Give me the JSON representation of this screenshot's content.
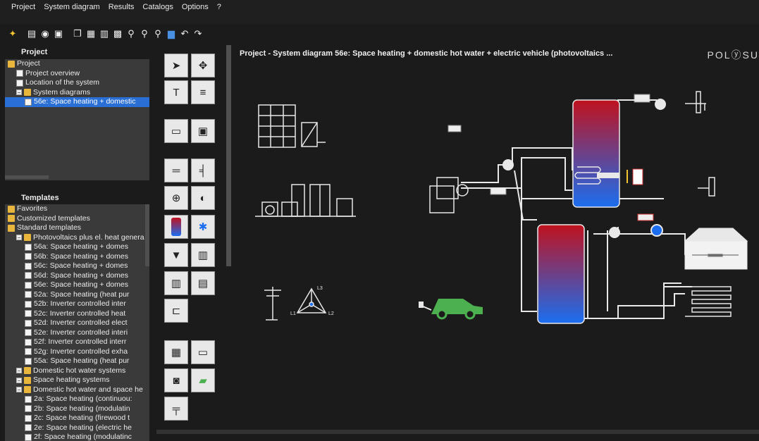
{
  "menu": [
    "Project",
    "System diagram",
    "Results",
    "Catalogs",
    "Options",
    "?"
  ],
  "toolbar_icons": [
    "wizard-icon",
    "new-icon",
    "open-icon",
    "save-icon",
    "copy-icon",
    "paste-icon",
    "delete-icon",
    "save-as-icon",
    "zoom-icon",
    "zoom-in-icon",
    "zoom-out-icon",
    "chart-icon",
    "undo-icon",
    "redo-icon"
  ],
  "project_panel": {
    "title": "Project",
    "items": [
      {
        "label": "Project",
        "level": 0,
        "icon": "folder"
      },
      {
        "label": "Project overview",
        "level": 1,
        "icon": "doc"
      },
      {
        "label": "Location of the system",
        "level": 1,
        "icon": "doc"
      },
      {
        "label": "System diagrams",
        "level": 1,
        "icon": "folder"
      },
      {
        "label": "56e: Space heating + domestic",
        "level": 2,
        "icon": "doc",
        "selected": true
      }
    ]
  },
  "templates_panel": {
    "title": "Templates",
    "items": [
      {
        "label": "Favorites",
        "level": 0,
        "icon": "folder"
      },
      {
        "label": "Customized templates",
        "level": 0,
        "icon": "folder"
      },
      {
        "label": "Standard templates",
        "level": 0,
        "icon": "folder"
      },
      {
        "label": "Photovoltaics plus el. heat genera",
        "level": 1,
        "icon": "folder"
      },
      {
        "label": "56a: Space heating + domes",
        "level": 2,
        "icon": "doc"
      },
      {
        "label": "56b: Space heating + domes",
        "level": 2,
        "icon": "doc"
      },
      {
        "label": "56c: Space heating + domes",
        "level": 2,
        "icon": "doc"
      },
      {
        "label": "56d: Space heating + domes",
        "level": 2,
        "icon": "doc"
      },
      {
        "label": "56e: Space heating + domes",
        "level": 2,
        "icon": "doc"
      },
      {
        "label": "52a: Space heating (heat pur",
        "level": 2,
        "icon": "doc"
      },
      {
        "label": "52b: Inverter controlled inter",
        "level": 2,
        "icon": "doc"
      },
      {
        "label": "52c: Inverter controlled heat",
        "level": 2,
        "icon": "doc"
      },
      {
        "label": "52d: Inverter controlled elect",
        "level": 2,
        "icon": "doc"
      },
      {
        "label": "52e: Inverter controlled interi",
        "level": 2,
        "icon": "doc"
      },
      {
        "label": "52f: Inverter controlled interr",
        "level": 2,
        "icon": "doc"
      },
      {
        "label": "52g: Inverter controlled exha",
        "level": 2,
        "icon": "doc"
      },
      {
        "label": "55a: Space heating (heat pur",
        "level": 2,
        "icon": "doc"
      },
      {
        "label": "Domestic hot water systems",
        "level": 1,
        "icon": "folder"
      },
      {
        "label": "Space heating systems",
        "level": 1,
        "icon": "folder"
      },
      {
        "label": "Domestic hot water and space he",
        "level": 1,
        "icon": "folder"
      },
      {
        "label": "2a: Space heating (continuou:",
        "level": 2,
        "icon": "doc"
      },
      {
        "label": "2b: Space heating (modulatin",
        "level": 2,
        "icon": "doc"
      },
      {
        "label": "2c: Space heating (firewood t",
        "level": 2,
        "icon": "doc"
      },
      {
        "label": "2e: Space heating (electric he",
        "level": 2,
        "icon": "doc"
      },
      {
        "label": "2f: Space heating (modulatinc",
        "level": 2,
        "icon": "doc"
      }
    ]
  },
  "canvas": {
    "title": "Project - System diagram 56e: Space heating + domestic hot water + electric vehicle (photovoltaics ...",
    "logo": "POLⓨSU",
    "grid_labels": {
      "l1": "L1",
      "l2": "L2",
      "l3": "L3"
    }
  },
  "colors": {
    "background": "#1b1b1b",
    "selection": "#2a6fd6",
    "folder": "#e8b63c",
    "tank_top": "#c0121e",
    "tank_bottom": "#1b6ef0",
    "car": "#4caf50"
  }
}
